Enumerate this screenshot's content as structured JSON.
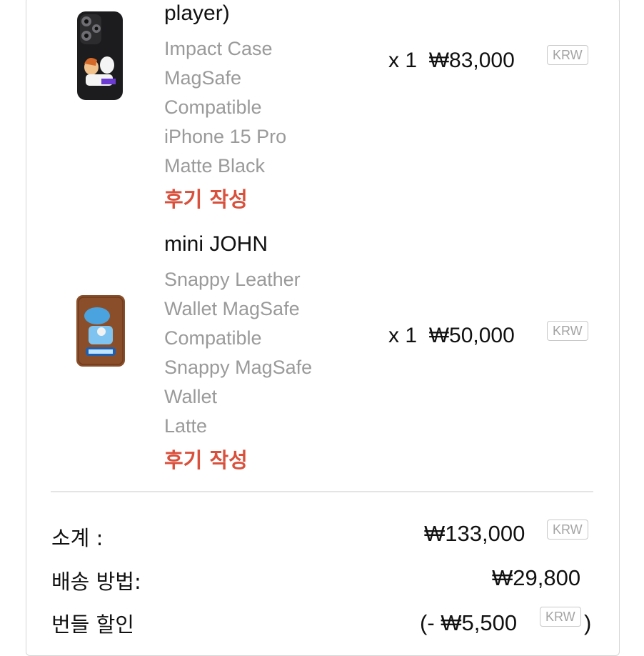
{
  "items": [
    {
      "name": "player)",
      "variant_lines": [
        "Impact Case",
        "MagSafe",
        "Compatible",
        "iPhone 15 Pro",
        "Matte Black"
      ],
      "review_label": "후기 작성",
      "qty": "x 1",
      "price": "₩83,000",
      "currency": "KRW",
      "image": "phone-case-image"
    },
    {
      "name": "mini JOHN",
      "variant_lines": [
        "Snappy Leather",
        "Wallet MagSafe",
        "Compatible",
        "Snappy MagSafe",
        "Wallet",
        "Latte"
      ],
      "review_label": "후기 작성",
      "qty": "x 1",
      "price": "₩50,000",
      "currency": "KRW",
      "image": "card-wallet-image"
    }
  ],
  "summary": {
    "subtotal_label": "소계 :",
    "subtotal_value": "₩133,000",
    "subtotal_currency": "KRW",
    "shipping_label": "배송 방법:",
    "shipping_value": "₩29,800",
    "discount_label": "번들 할인",
    "discount_prefix": "(- ₩5,500",
    "discount_currency": "KRW",
    "discount_suffix": ")"
  },
  "colors": {
    "review_link": "#d9503c",
    "variant_text": "#9a9a9a",
    "case_body": "#1c1c1e",
    "wallet_leather": "#8a4f2a"
  }
}
